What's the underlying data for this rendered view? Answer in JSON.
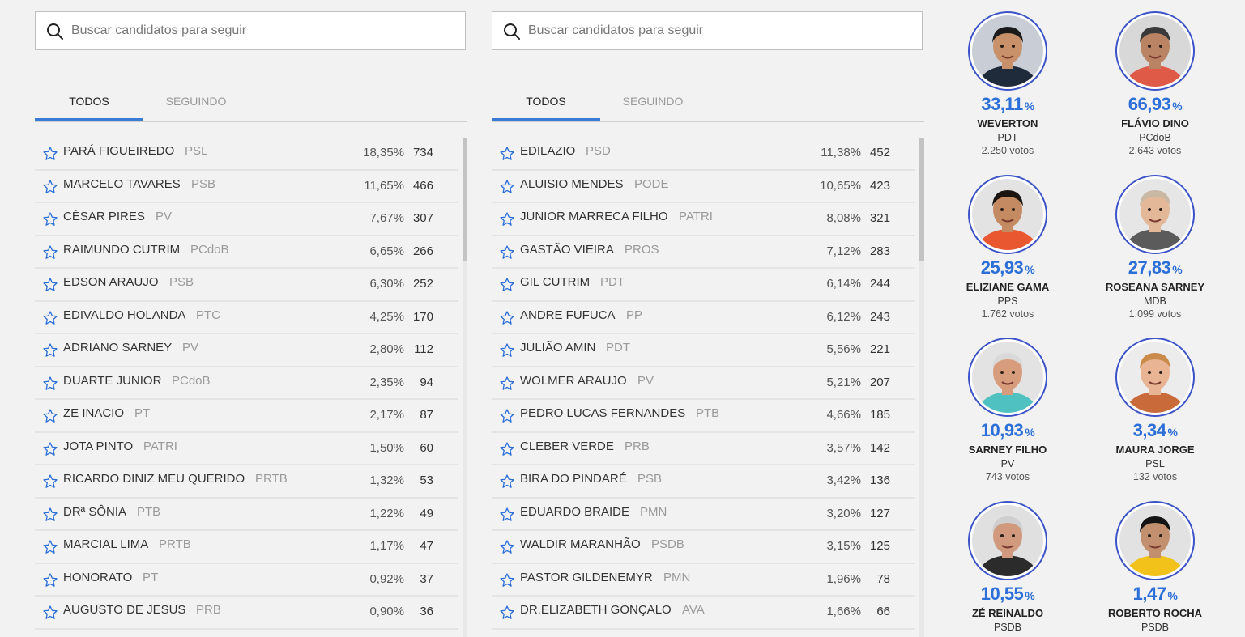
{
  "search": {
    "placeholder": "Buscar candidatos para seguir"
  },
  "tabs": {
    "all": "TODOS",
    "following": "SEGUINDO"
  },
  "percent_sign": "%",
  "left_list": [
    {
      "name": "PARÁ FIGUEIREDO",
      "party": "PSL",
      "pct": "18,35%",
      "votes": "734"
    },
    {
      "name": "MARCELO TAVARES",
      "party": "PSB",
      "pct": "11,65%",
      "votes": "466"
    },
    {
      "name": "CÉSAR PIRES",
      "party": "PV",
      "pct": "7,67%",
      "votes": "307"
    },
    {
      "name": "RAIMUNDO CUTRIM",
      "party": "PCdoB",
      "pct": "6,65%",
      "votes": "266"
    },
    {
      "name": "EDSON ARAUJO",
      "party": "PSB",
      "pct": "6,30%",
      "votes": "252"
    },
    {
      "name": "EDIVALDO HOLANDA",
      "party": "PTC",
      "pct": "4,25%",
      "votes": "170"
    },
    {
      "name": "ADRIANO SARNEY",
      "party": "PV",
      "pct": "2,80%",
      "votes": "112"
    },
    {
      "name": "DUARTE JUNIOR",
      "party": "PCdoB",
      "pct": "2,35%",
      "votes": "94"
    },
    {
      "name": "ZE INACIO",
      "party": "PT",
      "pct": "2,17%",
      "votes": "87"
    },
    {
      "name": "JOTA PINTO",
      "party": "PATRI",
      "pct": "1,50%",
      "votes": "60"
    },
    {
      "name": "RICARDO DINIZ MEU QUERIDO",
      "party": "PRTB",
      "pct": "1,32%",
      "votes": "53"
    },
    {
      "name": "DRª SÔNIA",
      "party": "PTB",
      "pct": "1,22%",
      "votes": "49"
    },
    {
      "name": "MARCIAL LIMA",
      "party": "PRTB",
      "pct": "1,17%",
      "votes": "47"
    },
    {
      "name": "HONORATO",
      "party": "PT",
      "pct": "0,92%",
      "votes": "37"
    },
    {
      "name": "AUGUSTO DE JESUS",
      "party": "PRB",
      "pct": "0,90%",
      "votes": "36"
    }
  ],
  "right_list": [
    {
      "name": "EDILAZIO",
      "party": "PSD",
      "pct": "11,38%",
      "votes": "452"
    },
    {
      "name": "ALUISIO MENDES",
      "party": "PODE",
      "pct": "10,65%",
      "votes": "423"
    },
    {
      "name": "JUNIOR MARRECA FILHO",
      "party": "PATRI",
      "pct": "8,08%",
      "votes": "321"
    },
    {
      "name": "GASTÃO VIEIRA",
      "party": "PROS",
      "pct": "7,12%",
      "votes": "283"
    },
    {
      "name": "GIL CUTRIM",
      "party": "PDT",
      "pct": "6,14%",
      "votes": "244"
    },
    {
      "name": "ANDRE FUFUCA",
      "party": "PP",
      "pct": "6,12%",
      "votes": "243"
    },
    {
      "name": "JULIÃO AMIN",
      "party": "PDT",
      "pct": "5,56%",
      "votes": "221"
    },
    {
      "name": "WOLMER ARAUJO",
      "party": "PV",
      "pct": "5,21%",
      "votes": "207"
    },
    {
      "name": "PEDRO LUCAS FERNANDES",
      "party": "PTB",
      "pct": "4,66%",
      "votes": "185"
    },
    {
      "name": "CLEBER VERDE",
      "party": "PRB",
      "pct": "3,57%",
      "votes": "142"
    },
    {
      "name": "BIRA DO PINDARÉ",
      "party": "PSB",
      "pct": "3,42%",
      "votes": "136"
    },
    {
      "name": "EDUARDO BRAIDE",
      "party": "PMN",
      "pct": "3,20%",
      "votes": "127"
    },
    {
      "name": "WALDIR MARANHÃO",
      "party": "PSDB",
      "pct": "3,15%",
      "votes": "125"
    },
    {
      "name": "PASTOR GILDENEMYR",
      "party": "PMN",
      "pct": "1,96%",
      "votes": "78"
    },
    {
      "name": "DR.ELIZABETH GONÇALO",
      "party": "AVA",
      "pct": "1,66%",
      "votes": "66"
    }
  ],
  "cards": [
    {
      "pct": "33,11",
      "name": "WEVERTON",
      "party": "PDT",
      "votes": "2.250  votos",
      "bg": "#c9ced6",
      "skin": "#c8916a",
      "shirt": "#1f2a3a",
      "hair": "#1a1a1a"
    },
    {
      "pct": "66,93",
      "name": "FLÁVIO DINO",
      "party": "PCdoB",
      "votes": "2.643  votos",
      "bg": "#d8d8d8",
      "skin": "#b98364",
      "shirt": "#e05a48",
      "hair": "#3a3a3a"
    },
    {
      "pct": "25,93",
      "name": "ELIZIANE GAMA",
      "party": "PPS",
      "votes": "1.762  votos",
      "bg": "#e3e3e3",
      "skin": "#c48a62",
      "shirt": "#e8572f",
      "hair": "#1b1512"
    },
    {
      "pct": "27,83",
      "name": "ROSEANA SARNEY",
      "party": "MDB",
      "votes": "1.099  votos",
      "bg": "#e6e6e6",
      "skin": "#e3b899",
      "shirt": "#5b5b5b",
      "hair": "#c9b8a4"
    },
    {
      "pct": "10,93",
      "name": "SARNEY FILHO",
      "party": "PV",
      "votes": "743  votos",
      "bg": "#e3e3e3",
      "skin": "#d79c7c",
      "shirt": "#4fc1c1",
      "hair": "#d9d9d9"
    },
    {
      "pct": "3,34",
      "name": "MAURA JORGE",
      "party": "PSL",
      "votes": "132  votos",
      "bg": "#ececec",
      "skin": "#e8b493",
      "shirt": "#c86a3a",
      "hair": "#c98a4a"
    },
    {
      "pct": "10,55",
      "name": "ZÉ REINALDO",
      "party": "PSDB",
      "votes": "",
      "bg": "#e0e0e0",
      "skin": "#d19a7e",
      "shirt": "#2b2b2b",
      "hair": "#cfcfcf"
    },
    {
      "pct": "1,47",
      "name": "ROBERTO ROCHA",
      "party": "PSDB",
      "votes": "",
      "bg": "#e2e2e2",
      "skin": "#c3906f",
      "shirt": "#f2c21a",
      "hair": "#141414"
    }
  ]
}
